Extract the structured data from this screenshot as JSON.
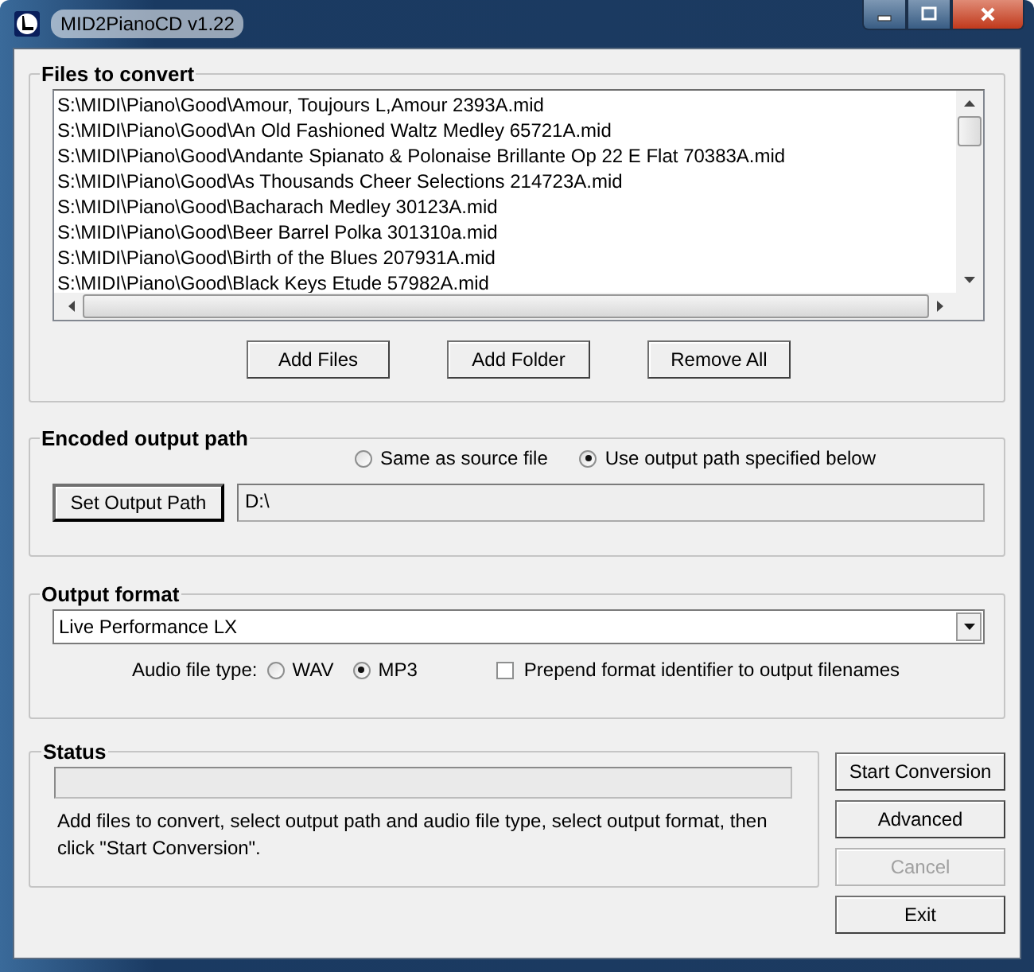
{
  "window": {
    "title": "MID2PianoCD v1.22"
  },
  "files_group": {
    "title": "Files to convert",
    "files": [
      "S:\\MIDI\\Piano\\Good\\Amour, Toujours L,Amour 2393A.mid",
      "S:\\MIDI\\Piano\\Good\\An Old Fashioned Waltz Medley 65721A.mid",
      "S:\\MIDI\\Piano\\Good\\Andante Spianato & Polonaise Brillante Op 22 E Flat 70383A.mid",
      "S:\\MIDI\\Piano\\Good\\As Thousands Cheer Selections 214723A.mid",
      "S:\\MIDI\\Piano\\Good\\Bacharach Medley 30123A.mid",
      "S:\\MIDI\\Piano\\Good\\Beer Barrel Polka 301310a.mid",
      "S:\\MIDI\\Piano\\Good\\Birth of the Blues 207931A.mid",
      "S:\\MIDI\\Piano\\Good\\Black Keys Etude 57982A.mid"
    ],
    "buttons": [
      "Add Files",
      "Add Folder",
      "Remove All"
    ]
  },
  "output_path_group": {
    "title": "Encoded output path",
    "options": [
      {
        "label": "Same as source file",
        "selected": false
      },
      {
        "label": "Use output path specified below",
        "selected": true
      }
    ],
    "set_button": "Set Output Path",
    "path": "D:\\"
  },
  "output_format_group": {
    "title": "Output format",
    "format": "Live Performance LX",
    "audio_type_label": "Audio file type:",
    "audio_types": [
      {
        "label": "WAV",
        "selected": false
      },
      {
        "label": "MP3",
        "selected": true
      }
    ],
    "prepend": {
      "label": "Prepend format identifier to output filenames",
      "checked": false
    }
  },
  "status_group": {
    "title": "Status",
    "progress": {
      "level": 0
    },
    "message": "Add files to convert, select output path and audio file type, select output format, then click \"Start Conversion\"."
  },
  "actions": [
    {
      "label": "Start Conversion",
      "disabled": false
    },
    {
      "label": "Advanced",
      "disabled": false
    },
    {
      "label": "Cancel",
      "disabled": true
    },
    {
      "label": "Exit",
      "disabled": false
    }
  ]
}
